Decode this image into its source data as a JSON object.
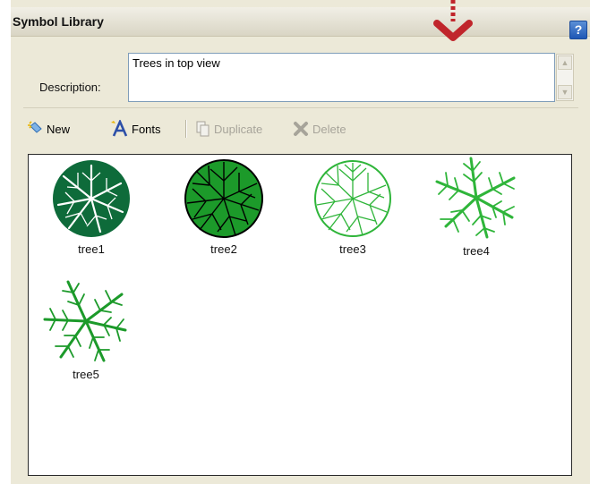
{
  "window": {
    "title": "Symbol Library",
    "help_icon": "help-icon",
    "help_glyph": "?"
  },
  "description": {
    "label": "Description:",
    "value": "Trees in top view"
  },
  "toolbar": {
    "new_label": "New",
    "fonts_label": "Fonts",
    "duplicate_label": "Duplicate",
    "delete_label": "Delete"
  },
  "symbols": [
    {
      "name": "tree1"
    },
    {
      "name": "tree2"
    },
    {
      "name": "tree3"
    },
    {
      "name": "tree4"
    },
    {
      "name": "tree5"
    }
  ],
  "colors": {
    "callout_arrow": "#c0252b",
    "tree_dark_green": "#0e6b3a",
    "tree_green": "#1c9a2a",
    "tree_light_green": "#2fb53a"
  }
}
